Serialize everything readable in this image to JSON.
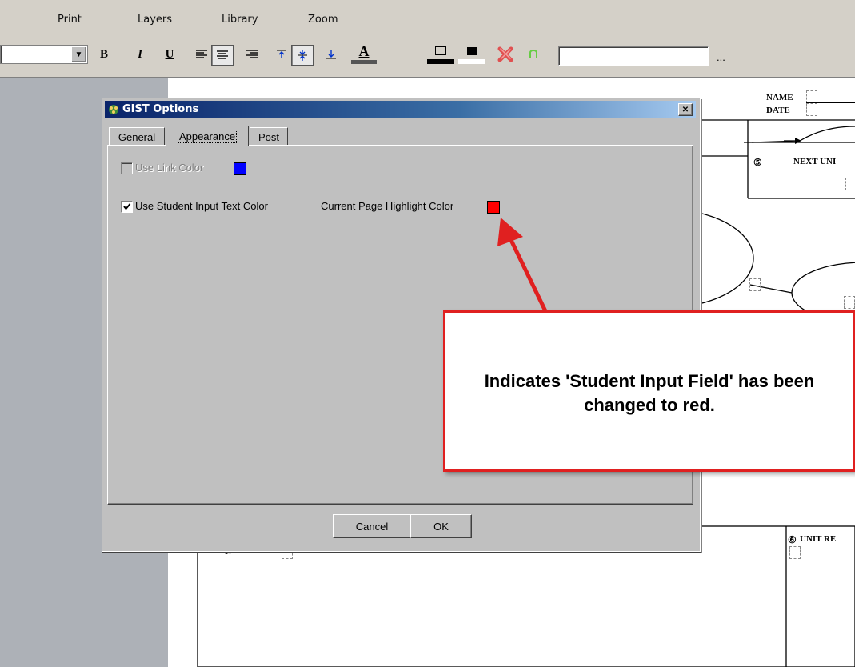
{
  "menu": [
    "Print",
    "Layers",
    "Library",
    "Zoom"
  ],
  "toolbar": {
    "bold": "B",
    "italic": "I",
    "underline": "U",
    "font_color_glyph": "A",
    "more": "..."
  },
  "dialog": {
    "title": "GIST Options",
    "close": "✕",
    "tabs": [
      "General",
      "Appearance",
      "Post"
    ],
    "use_link_color_label": "Use Link Color",
    "use_student_input_label": "Use Student Input Text Color",
    "current_page_highlight_label": "Current Page Highlight Color",
    "cancel_label": "Cancel",
    "ok_label": "OK",
    "link_color": "#0000ff",
    "highlight_color": "#ff0000"
  },
  "document": {
    "name_label": "NAME",
    "date_label": "DATE",
    "next_unit_label": "NEXT UNI",
    "unit_re_label": "UNIT RE",
    "item_number": "1."
  },
  "callout": {
    "text": "Indicates 'Student Input Field' has been changed to red.",
    "border_color": "#e02020",
    "arrow_color": "#e02020"
  }
}
